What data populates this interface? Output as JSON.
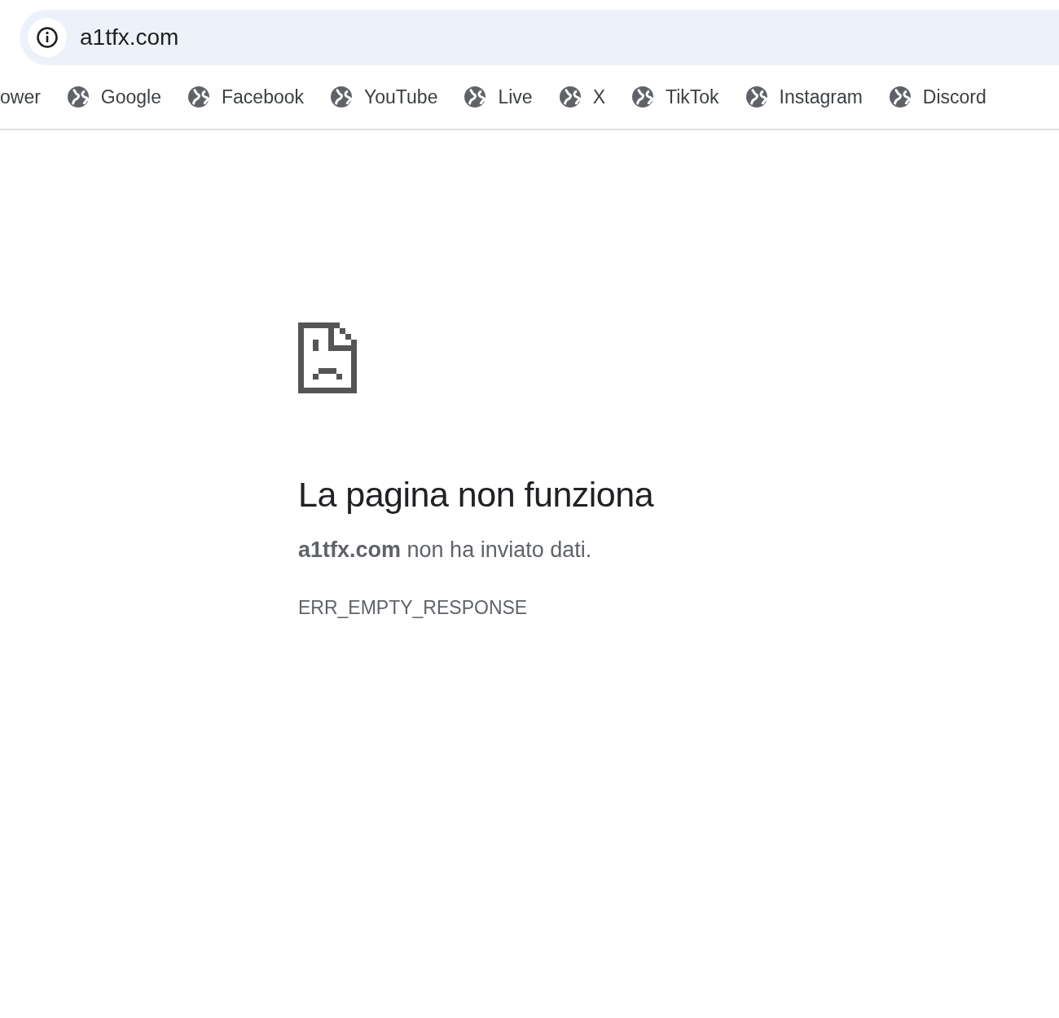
{
  "address_bar": {
    "url": "a1tfx.com"
  },
  "bookmarks": [
    {
      "label": "ower",
      "kind": "cut"
    },
    {
      "label": "Google",
      "kind": "site"
    },
    {
      "label": "Facebook",
      "kind": "site"
    },
    {
      "label": "YouTube",
      "kind": "site"
    },
    {
      "label": "Live",
      "kind": "site"
    },
    {
      "label": "X",
      "kind": "site"
    },
    {
      "label": "TikTok",
      "kind": "site"
    },
    {
      "label": "Instagram",
      "kind": "site"
    },
    {
      "label": "Discord",
      "kind": "site"
    }
  ],
  "error": {
    "title": "La pagina non funziona",
    "message": "**a1tfx.com** non ha inviato dati.",
    "code": "ERR_EMPTY_RESPONSE"
  }
}
